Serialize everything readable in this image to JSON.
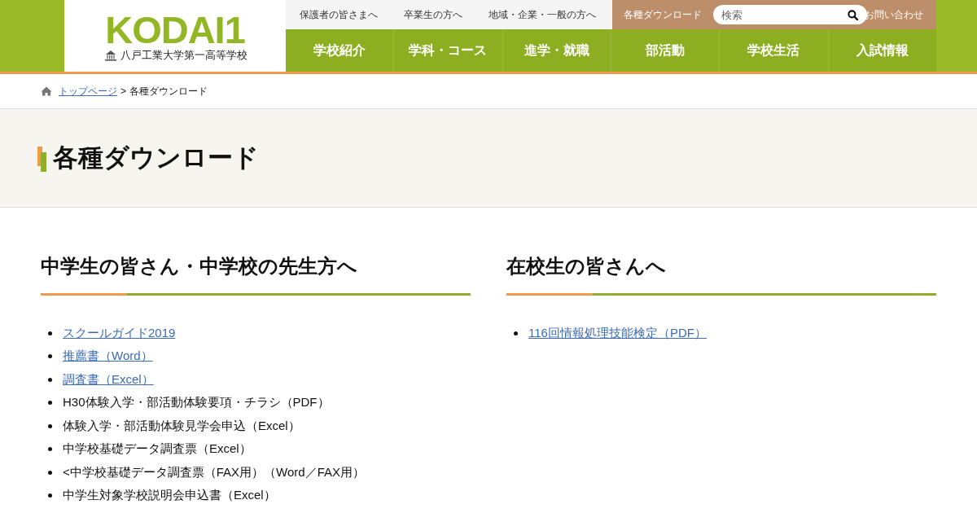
{
  "logo": {
    "wordmark": "KODAI1",
    "school_name": "八戸工業大学第一高等学校"
  },
  "top_links": [
    "保護者の皆さまへ",
    "卒業生の方へ",
    "地域・企業・一般の方へ"
  ],
  "utility": {
    "download_link": "各種ダウンロード",
    "search": {
      "placeholder": "検索"
    },
    "contact_link": "お問い合わせ"
  },
  "main_nav": [
    "学校紹介",
    "学科・コース",
    "進学・就職",
    "部活動",
    "学校生活",
    "入試情報"
  ],
  "breadcrumb": {
    "home_link": "トップページ",
    "separator": ">",
    "current": "各種ダウンロード"
  },
  "page_title": "各種ダウンロード",
  "sections": [
    {
      "heading": "中学生の皆さん・中学校の先生方へ",
      "items": [
        {
          "label": "スクールガイド2019",
          "kind": "link"
        },
        {
          "label": "推薦書（Word）",
          "kind": "link"
        },
        {
          "label": "調査書（Excel）",
          "kind": "link"
        },
        {
          "label": "H30体験入学・部活動体験要項・チラシ（PDF）",
          "kind": "text"
        },
        {
          "label": "体験入学・部活動体験見学会申込（Excel）",
          "kind": "text"
        },
        {
          "label": "中学校基礎データ調査票（Excel）",
          "kind": "text"
        },
        {
          "label": "<中学校基礎データ調査票（FAX用）（Word／FAX用）",
          "kind": "text"
        },
        {
          "label": "中学生対象学校説明会申込書（Excel）",
          "kind": "text"
        }
      ]
    },
    {
      "heading": "在校生の皆さんへ",
      "items": [
        {
          "label": "116回情報処理技能検定（PDF）",
          "kind": "link"
        }
      ]
    }
  ]
}
